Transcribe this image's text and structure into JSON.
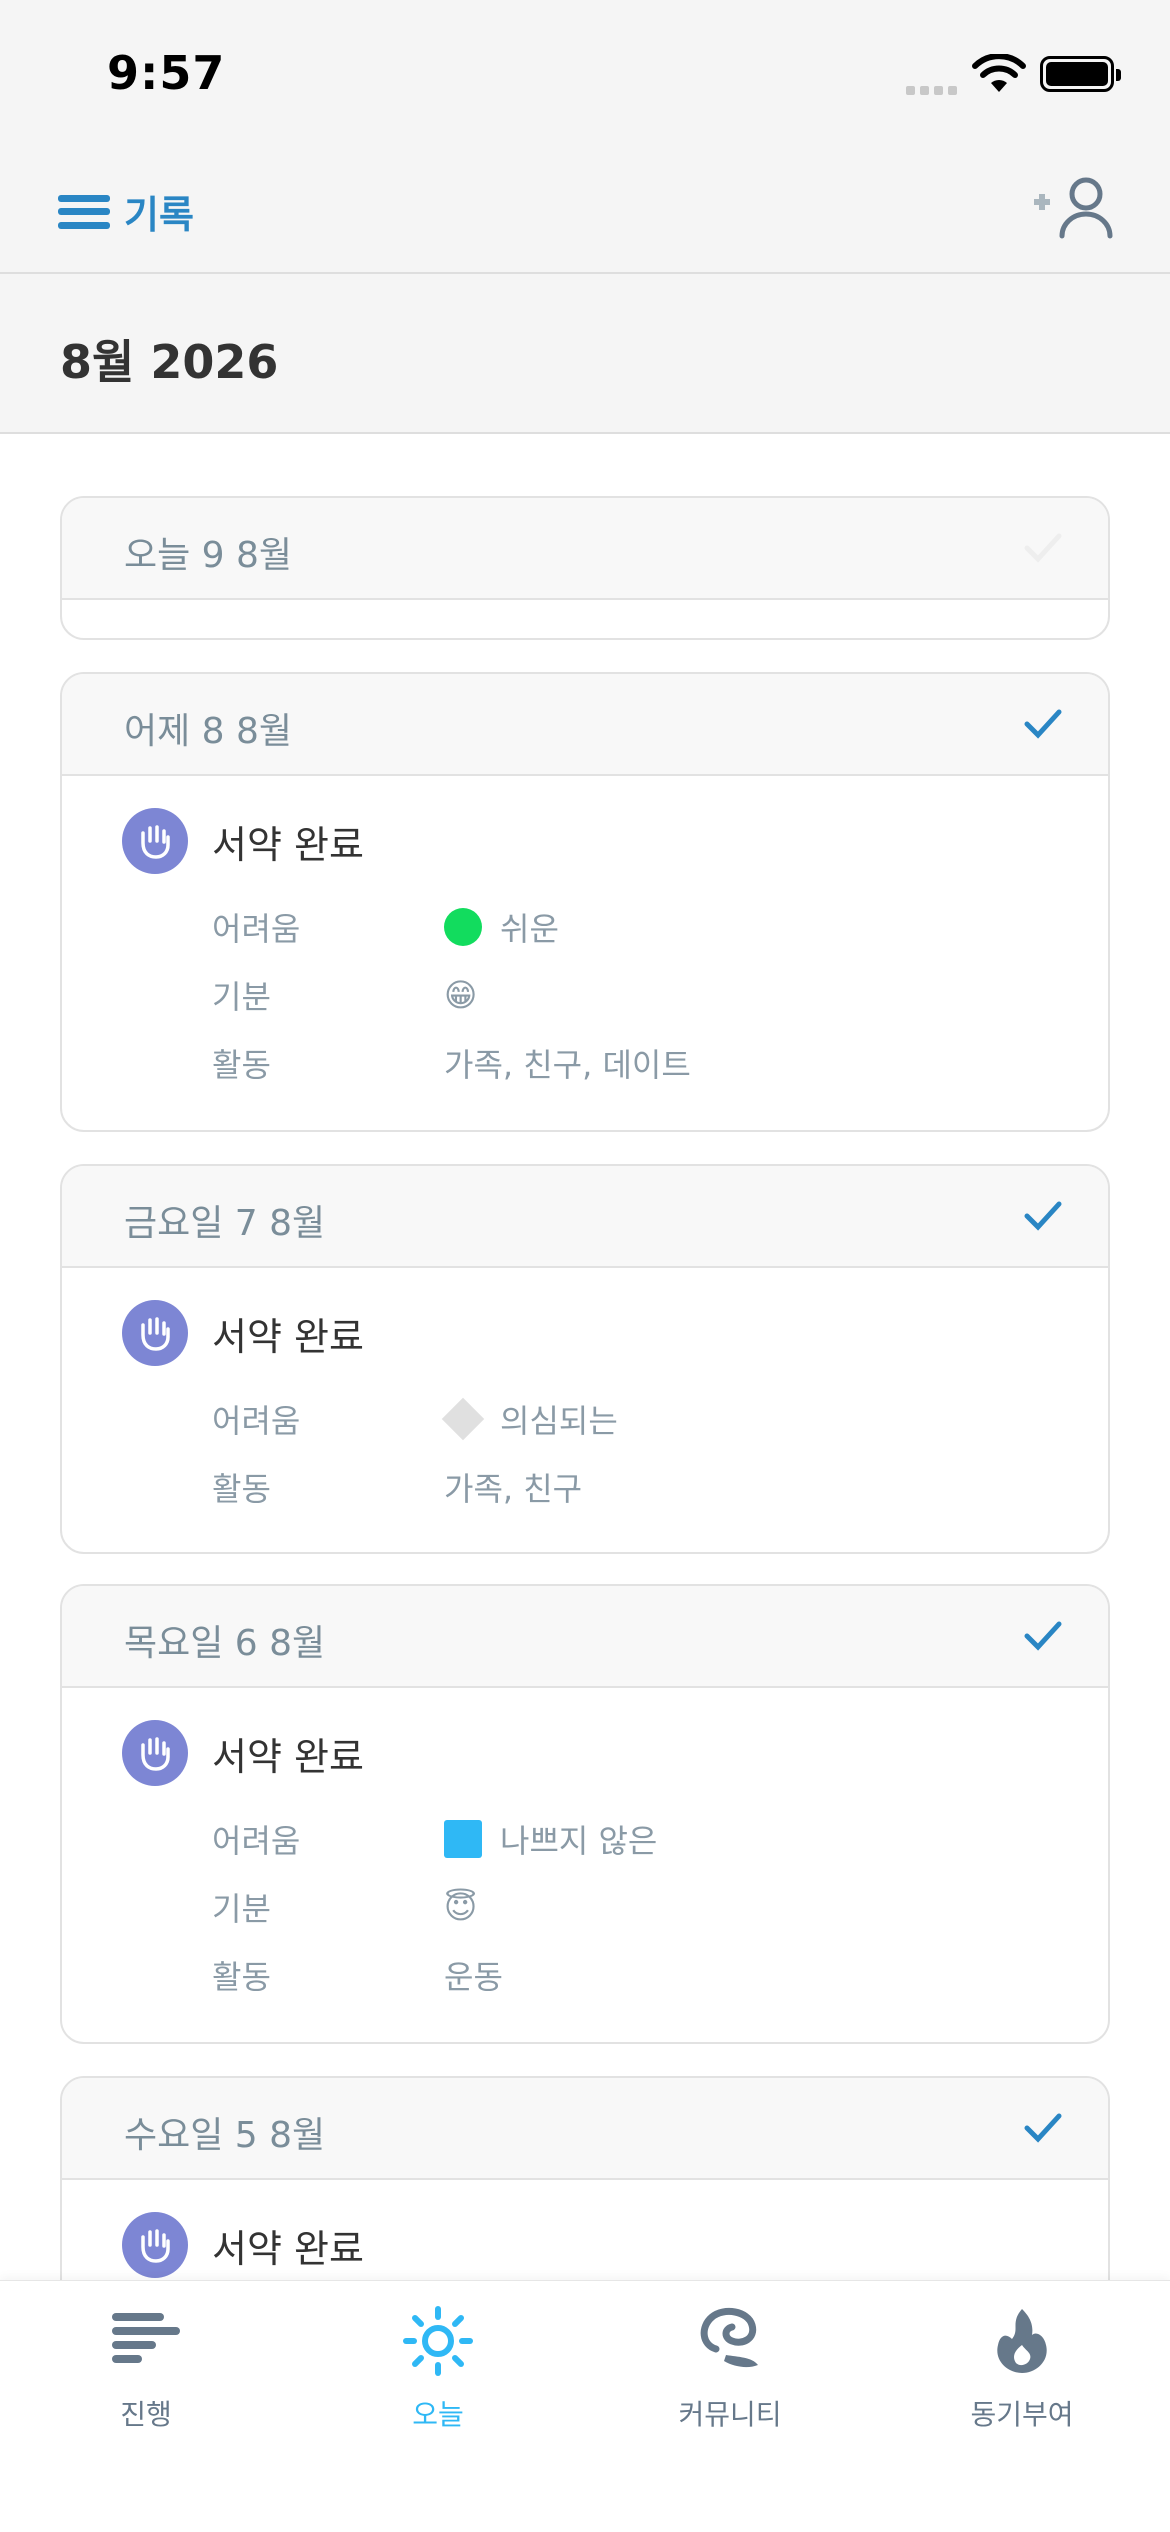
{
  "status": {
    "time": "9:57"
  },
  "nav": {
    "menu_label": "기록"
  },
  "month": {
    "title": "8월 2026"
  },
  "labels": {
    "difficulty": "어려움",
    "mood": "기분",
    "activity": "활동"
  },
  "cards": [
    {
      "date": "오늘 9 8월",
      "checked": false
    },
    {
      "date": "어제 8 8월",
      "checked": true,
      "pledge": "서약 완료",
      "difficulty": "쉬운",
      "difficulty_color": "#12dc5e",
      "mood_emoji": "😁",
      "activity": "가족, 친구, 데이트"
    },
    {
      "date": "금요일 7 8월",
      "checked": true,
      "pledge": "서약 완료",
      "difficulty": "의심되는",
      "activity": "가족, 친구"
    },
    {
      "date": "목요일 6 8월",
      "checked": true,
      "pledge": "서약 완료",
      "difficulty": "나쁘지 않은",
      "difficulty_color": "#2fb8f5",
      "mood_emoji": "😇",
      "activity": "운동"
    },
    {
      "date": "수요일 5 8월",
      "checked": true,
      "pledge": "서약 완료"
    }
  ],
  "tabs": [
    {
      "label": "진행",
      "icon": "progress-bars-icon"
    },
    {
      "label": "오늘",
      "icon": "sun-icon",
      "active": true
    },
    {
      "label": "커뮤니티",
      "icon": "chat-bubble-icon"
    },
    {
      "label": "동기부여",
      "icon": "flame-icon"
    }
  ],
  "colors": {
    "accent": "#2a86c4",
    "active_tab": "#2fb8f5",
    "pledge_icon": "#7d86d4"
  }
}
